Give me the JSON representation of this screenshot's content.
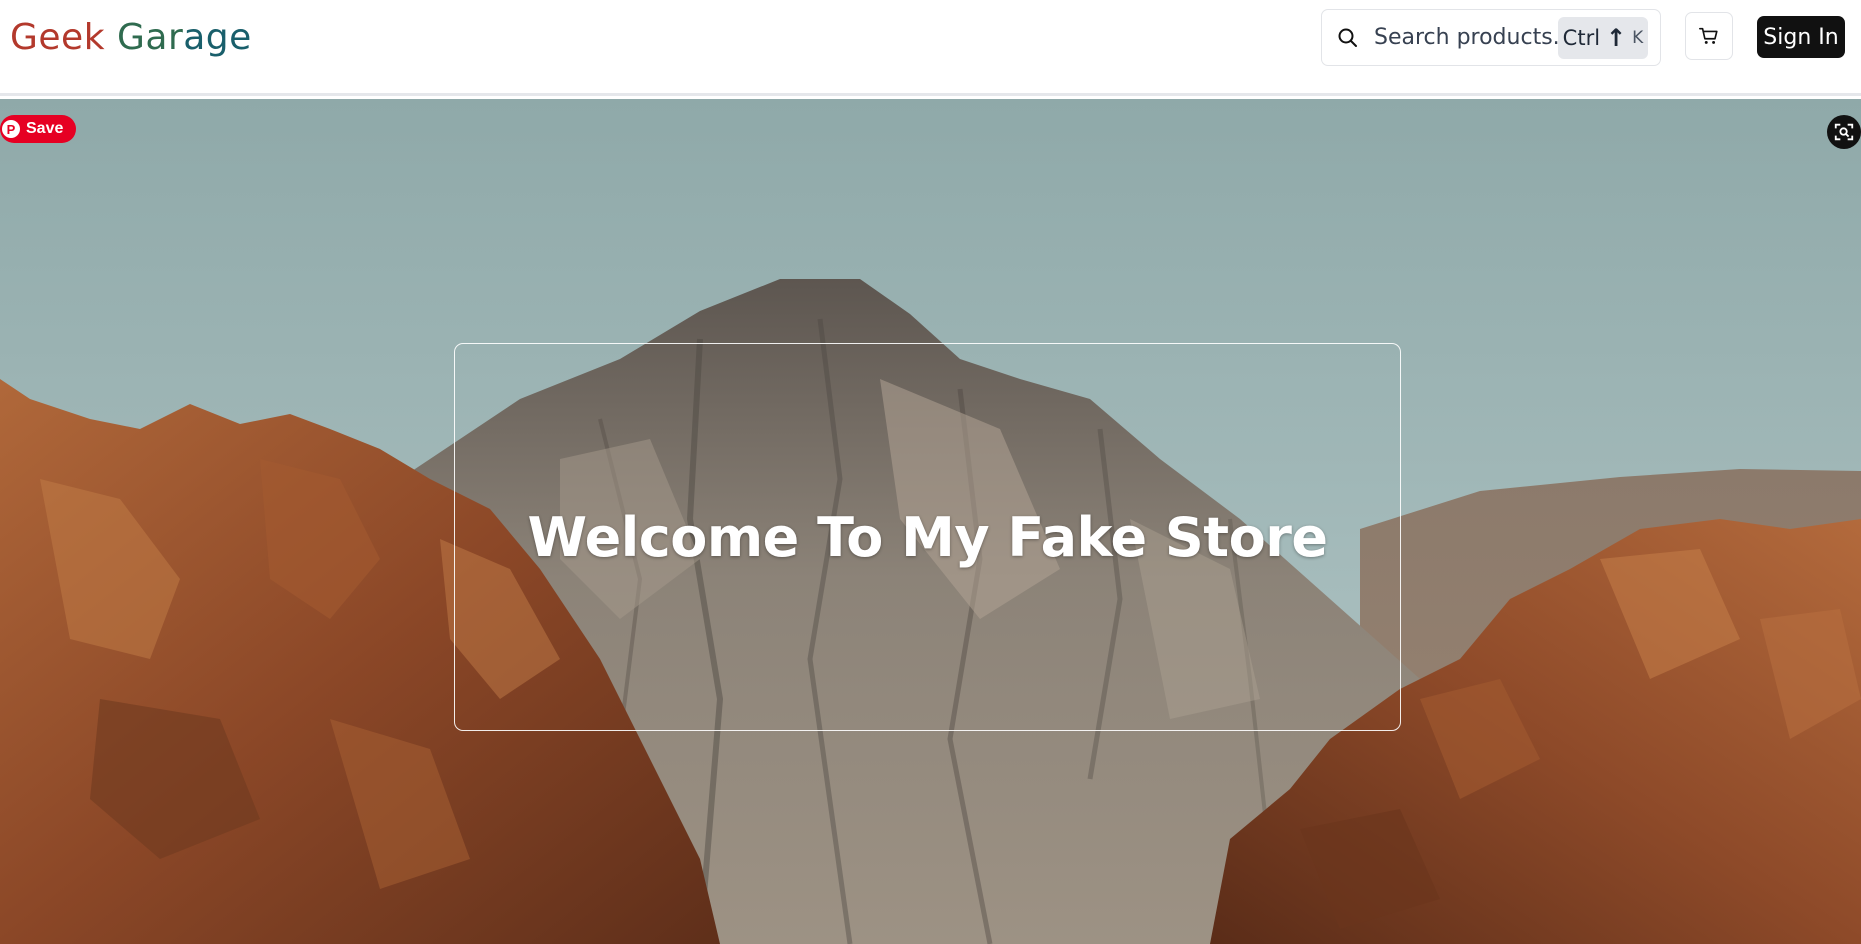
{
  "header": {
    "logo_part1": "Geek ",
    "logo_part2": "Gar",
    "logo_part3": "age",
    "search_placeholder": "Search products...",
    "shortcut_ctrl": "Ctrl",
    "shortcut_symbol": "↑",
    "shortcut_key": "K",
    "cart_icon": "cart-icon",
    "sign_in_label": "Sign In"
  },
  "hero": {
    "pinterest_save_label": "Save",
    "headline": "Welcome To My Fake Store",
    "lens_icon": "visual-search-icon"
  },
  "colors": {
    "logo_red": "#b3392c",
    "logo_green": "#2f6b4f",
    "logo_teal": "#195f6b",
    "sign_in_bg": "#111111",
    "pinterest_red": "#e60023"
  }
}
